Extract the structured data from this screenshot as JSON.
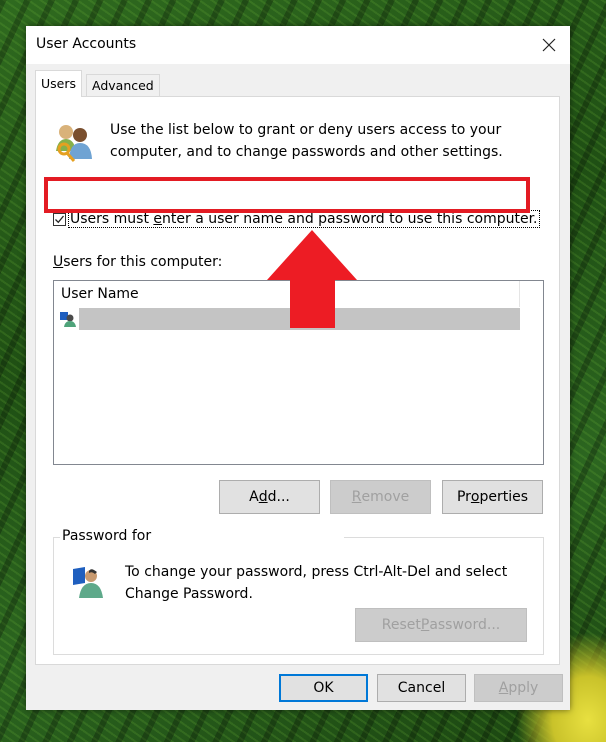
{
  "window": {
    "title": "User Accounts",
    "close_label": "close"
  },
  "tabs": [
    {
      "label": "Users",
      "active": true
    },
    {
      "label": "Advanced",
      "active": false
    }
  ],
  "intro": {
    "line1": "Use the list below to grant or deny users access to your",
    "line2": "computer, and to change passwords and other settings.",
    "icon": "users-key-icon"
  },
  "require_login": {
    "checked": true,
    "label_pre": "Users must ",
    "label_accel": "e",
    "label_post": "nter a user name and password to use this computer."
  },
  "users_list": {
    "label_accel": "U",
    "label_rest": "sers for this computer:",
    "column_header": "User Name",
    "rows": [
      {
        "name": "",
        "redacted": true,
        "selected": true
      }
    ]
  },
  "list_buttons": {
    "add": {
      "pre": "A",
      "accel": "d",
      "post": "d...",
      "enabled": true
    },
    "remove": {
      "pre": "",
      "accel": "R",
      "post": "emove",
      "enabled": false
    },
    "properties": {
      "pre": "Pr",
      "accel": "o",
      "post": "perties",
      "enabled": true
    }
  },
  "password_group": {
    "legend": "Password for",
    "line1": "To change your password, press Ctrl-Alt-Del and select",
    "line2": "Change Password.",
    "reset_button": {
      "pre": "Reset ",
      "accel": "P",
      "post": "assword...",
      "enabled": false
    }
  },
  "footer": {
    "ok": "OK",
    "cancel": "Cancel",
    "apply": {
      "accel": "A",
      "post": "pply",
      "enabled": false
    }
  },
  "annotation": {
    "type": "red-arrow-up",
    "highlight_color": "#e31b23"
  }
}
